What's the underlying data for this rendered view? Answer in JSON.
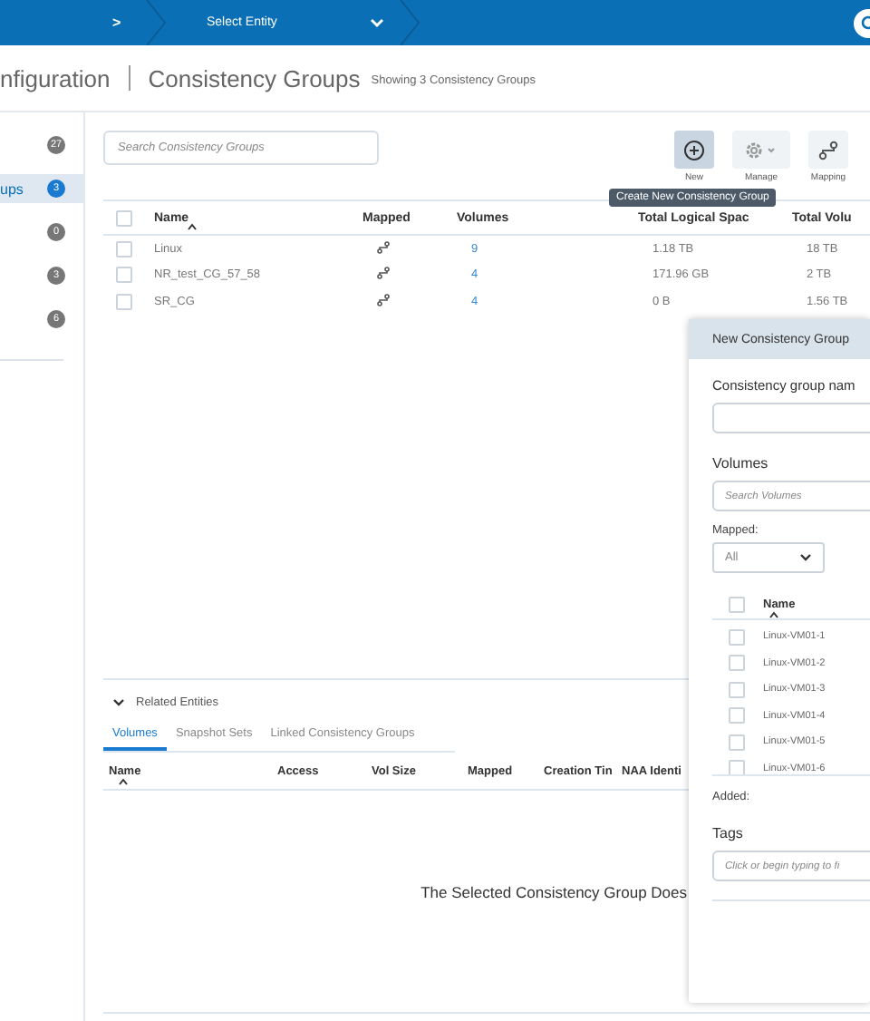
{
  "top_bar": {
    "separator": ">",
    "entity_selector": "Select Entity"
  },
  "header": {
    "section": "nfiguration",
    "title": "Consistency Groups",
    "subtitle": "Showing 3 Consistency Groups"
  },
  "sidebar": {
    "items": [
      {
        "count": "27",
        "selected": false
      },
      {
        "label": "ups",
        "count": "3",
        "selected": true
      },
      {
        "count": "0",
        "selected": false
      },
      {
        "count": "3",
        "selected": false
      },
      {
        "count": "6",
        "selected": false
      }
    ]
  },
  "toolbar": {
    "search_placeholder": "Search Consistency Groups",
    "buttons": [
      {
        "kind": "new",
        "label": "New",
        "selected": true
      },
      {
        "kind": "manage",
        "label": "Manage",
        "selected": false
      },
      {
        "kind": "mapping",
        "label": "Mapping",
        "selected": false
      }
    ],
    "tooltip": "Create New Consistency Group"
  },
  "table": {
    "select_all_checked": false,
    "columns": [
      "Name",
      "Mapped",
      "Volumes",
      "Total Logical Spac",
      "Total Volu"
    ],
    "rows": [
      {
        "name": "Linux",
        "volumes": "9",
        "logical": "1.18 TB",
        "total": "18 TB",
        "checked": false
      },
      {
        "name": "NR_test_CG_57_58",
        "volumes": "4",
        "logical": "171.96 GB",
        "total": "2 TB",
        "checked": false
      },
      {
        "name": "SR_CG",
        "volumes": "4",
        "logical": "0 B",
        "total": "1.56 TB",
        "checked": false
      }
    ]
  },
  "related": {
    "title": "Related Entities",
    "expanded": true,
    "tabs": [
      {
        "label": "Volumes",
        "selected": true
      },
      {
        "label": "Snapshot Sets",
        "selected": false
      },
      {
        "label": "Linked Consistency Groups",
        "selected": false
      }
    ],
    "columns": [
      "Name",
      "Access",
      "Vol Size",
      "Mapped",
      "Creation Tin",
      "NAA Identi"
    ],
    "empty_message": "The Selected Consistency Group Does"
  },
  "dialog": {
    "title": "New Consistency Group",
    "name_label": "Consistency group nam",
    "volumes_label": "Volumes",
    "volumes_search_placeholder": "Search Volumes",
    "mapped_label": "Mapped:",
    "mapped_value": "All",
    "volume_column": "Name",
    "select_all_checked": false,
    "volumes": [
      {
        "name": "Linux-VM01-1",
        "checked": false
      },
      {
        "name": "Linux-VM01-2",
        "checked": false
      },
      {
        "name": "Linux-VM01-3",
        "checked": false
      },
      {
        "name": "Linux-VM01-4",
        "checked": false
      },
      {
        "name": "Linux-VM01-5",
        "checked": false
      },
      {
        "name": "Linux-VM01-6",
        "checked": false
      }
    ],
    "added_label": "Added:",
    "tags_label": "Tags",
    "tags_placeholder": "Click or begin typing to fi"
  }
}
